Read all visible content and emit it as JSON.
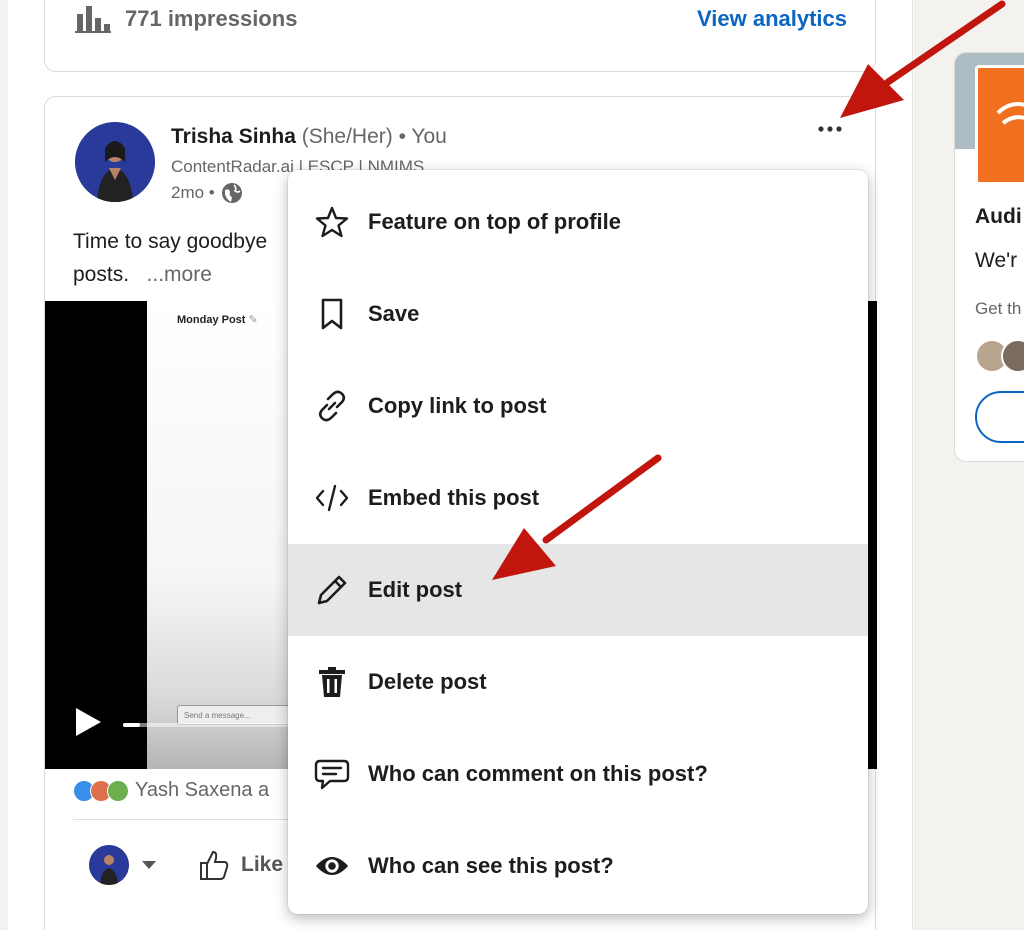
{
  "impressions": {
    "text": "771 impressions",
    "link": "View analytics"
  },
  "post": {
    "author_name": "Trisha Sinha",
    "author_pronoun": "(She/Her)",
    "author_you": "• You",
    "headline": "ContentRadar.ai | ESCP | NMIMS",
    "time": "2mo •",
    "text": "Time to say goodbye",
    "text_line2": "posts.",
    "more": "...more",
    "video_title": "Monday Post",
    "video_input_placeholder": "Send a message...",
    "video_progress": 0.05,
    "reactions_text": "Yash Saxena a",
    "like_label": "Like"
  },
  "menu": {
    "items": [
      {
        "label": "Feature on top of profile",
        "icon": "star-icon"
      },
      {
        "label": "Save",
        "icon": "bookmark-icon"
      },
      {
        "label": "Copy link to post",
        "icon": "link-icon"
      },
      {
        "label": "Embed this post",
        "icon": "code-icon"
      },
      {
        "label": "Edit post",
        "icon": "pencil-icon"
      },
      {
        "label": "Delete post",
        "icon": "trash-icon"
      },
      {
        "label": "Who can comment on this post?",
        "icon": "comment-icon"
      },
      {
        "label": "Who can see this post?",
        "icon": "eye-icon"
      }
    ],
    "active_index": 4
  },
  "sidebar_card": {
    "title": "Audi",
    "description": "We'r",
    "sub": "Get th"
  },
  "colors": {
    "brand": "#0a66c2",
    "arrow": "#c0160e",
    "highlight": "#e6e6e6"
  }
}
